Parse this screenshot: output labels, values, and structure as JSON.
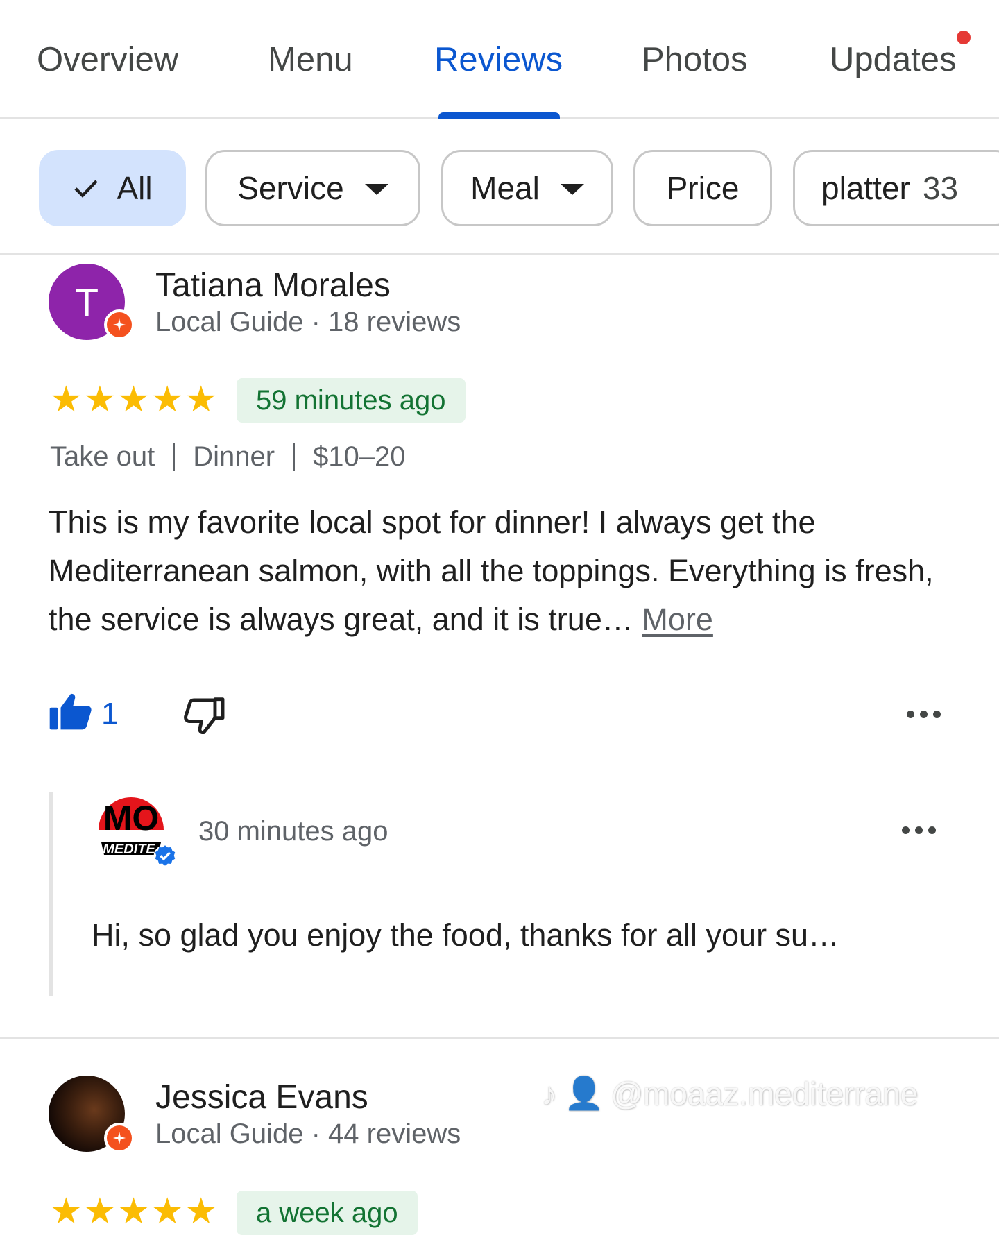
{
  "tabs": [
    {
      "label": "Overview",
      "active": false
    },
    {
      "label": "Menu",
      "active": false
    },
    {
      "label": "Reviews",
      "active": true
    },
    {
      "label": "Photos",
      "active": false
    },
    {
      "label": "Updates",
      "active": false,
      "has_notification": true
    }
  ],
  "filters": {
    "all": {
      "label": "All",
      "selected": true
    },
    "service": {
      "label": "Service",
      "has_dropdown": true
    },
    "meal": {
      "label": "Meal",
      "has_dropdown": true
    },
    "price": {
      "label": "Price"
    },
    "platter": {
      "label": "platter",
      "count": "33"
    }
  },
  "reviews": [
    {
      "avatar_initial": "T",
      "avatar_color": "#8e24aa",
      "name": "Tatiana Morales",
      "meta": "Local Guide · 18 reviews",
      "rating": 5,
      "time": "59 minutes ago",
      "attributes": [
        "Take out",
        "Dinner",
        "$10–20"
      ],
      "text": "This is my favorite local spot for dinner! I always get the Mediterranean salmon, with all the toppings. Everything is fresh, the service is always great, and it is true… ",
      "more_label": "More",
      "likes": "1",
      "owner_reply": {
        "logo_text": "MO",
        "logo_subtext": "MEDITE",
        "time": "30 minutes ago",
        "text": "Hi, so glad you enjoy the food, thanks for all your su…"
      }
    },
    {
      "name": "Jessica Evans",
      "meta": "Local Guide · 44 reviews",
      "rating": 5,
      "time": "a week ago"
    }
  ],
  "watermark": "@moaaz.mediterrane",
  "colors": {
    "accent": "#0b57d0",
    "star": "#fbbc04",
    "time_badge_bg": "#e6f4ea",
    "time_badge_text": "#137333",
    "guide_badge": "#f4511e",
    "notification": "#e53935"
  }
}
